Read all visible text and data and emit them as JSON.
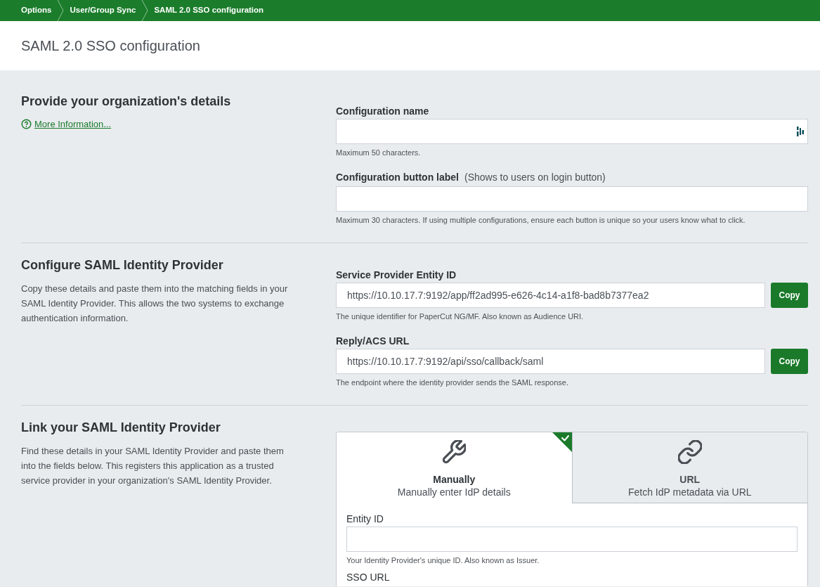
{
  "breadcrumbs": [
    {
      "label": "Options"
    },
    {
      "label": "User/Group Sync"
    },
    {
      "label": "SAML 2.0 SSO configuration"
    }
  ],
  "page_title": "SAML 2.0 SSO configuration",
  "sections": [
    {
      "heading": "Provide your organization's details",
      "link": "More Information...",
      "fields": [
        {
          "kind": "text",
          "label": "Configuration name",
          "autofill_icon": true,
          "help": "Maximum 50 characters."
        },
        {
          "kind": "text",
          "label": "Configuration button label",
          "note": "(Shows to users on login button)",
          "help": "Maximum 30 characters. If using multiple configurations, ensure each button is unique so your users know what to click."
        }
      ]
    },
    {
      "heading": "Configure SAML Identity Provider",
      "description": "Copy these details and paste them into the matching fields in your SAML Identity Provider. This allows the two systems to exchange authentication information.",
      "fields": [
        {
          "kind": "copy",
          "label": "Service Provider Entity ID",
          "value": "https://10.10.17.7:9192/app/ff2ad995-e626-4c14-a1f8-bad8b7377ea2",
          "button": "Copy",
          "help": "The unique identifier for PaperCut NG/MF. Also known as Audience URI."
        },
        {
          "kind": "copy",
          "label": "Reply/ACS URL",
          "value": "https://10.10.17.7:9192/api/sso/callback/saml",
          "button": "Copy",
          "help": "The endpoint where the identity provider sends the SAML response."
        }
      ]
    },
    {
      "heading": "Link your SAML Identity Provider",
      "description": "Find these details in your SAML Identity Provider and paste them into the fields below. This registers this application as a trusted service provider in your organization's SAML Identity Provider.",
      "tabs": [
        {
          "kind": "manual",
          "title": "Manually",
          "subtitle": "Manually enter IdP details",
          "selected": true
        },
        {
          "kind": "url",
          "title": "URL",
          "subtitle": "Fetch IdP metadata via URL",
          "selected": false
        }
      ],
      "tab_fields": [
        {
          "kind": "text",
          "label": "Entity ID",
          "help": "Your Identity Provider's unique ID. Also known as Issuer."
        },
        {
          "kind": "label",
          "label": "SSO URL"
        }
      ]
    }
  ]
}
